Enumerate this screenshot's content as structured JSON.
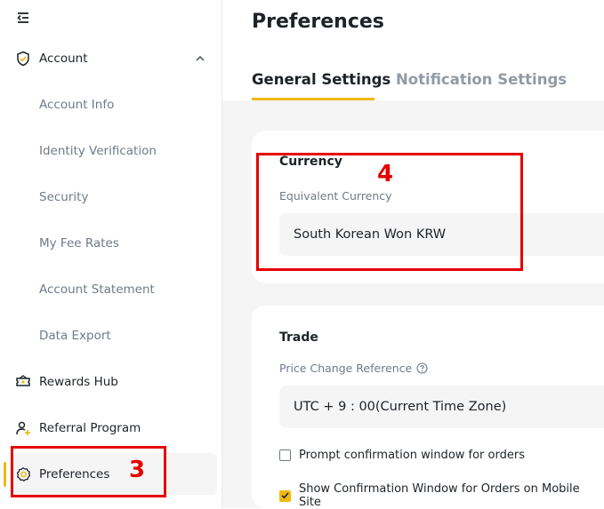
{
  "sidebar": {
    "collapse_icon": "collapse-menu-icon",
    "account": {
      "label": "Account",
      "icon": "shield-check-icon",
      "expanded": true
    },
    "sub_items": [
      {
        "label": "Account Info"
      },
      {
        "label": "Identity Verification"
      },
      {
        "label": "Security"
      },
      {
        "label": "My Fee Rates"
      },
      {
        "label": "Account Statement"
      },
      {
        "label": "Data Export"
      }
    ],
    "rewards": {
      "label": "Rewards Hub",
      "icon": "ticket-icon"
    },
    "referral": {
      "label": "Referral Program",
      "icon": "user-plus-icon"
    },
    "preferences": {
      "label": "Preferences",
      "icon": "gear-icon",
      "active": true
    }
  },
  "main": {
    "title": "Preferences",
    "tabs": [
      {
        "label": "General Settings",
        "active": true
      },
      {
        "label": "Notification Settings",
        "active": false
      }
    ],
    "currency": {
      "title": "Currency",
      "field_label": "Equivalent Currency",
      "value": "South Korean Won KRW"
    },
    "trade": {
      "title": "Trade",
      "field_label": "Price Change Reference",
      "help_icon": "question-circle-icon",
      "value": "UTC + 9 : 00(Current Time Zone)",
      "checkboxes": [
        {
          "label": "Prompt confirmation window for orders",
          "checked": false
        },
        {
          "label": "Show Confirmation Window for Orders on Mobile Site",
          "checked": true
        }
      ]
    }
  },
  "annotations": [
    {
      "label": "3"
    },
    {
      "label": "4"
    }
  ],
  "colors": {
    "accent": "#f0b90b",
    "annotation": "#e60000",
    "text": "#1e2329",
    "muted": "#707a8a"
  }
}
